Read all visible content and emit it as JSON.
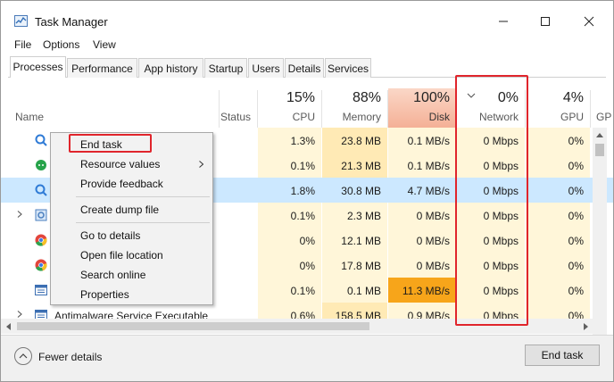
{
  "window": {
    "title": "Task Manager",
    "controls": [
      "minimize-icon",
      "maximize-icon",
      "close-icon"
    ]
  },
  "menu": [
    "File",
    "Options",
    "View"
  ],
  "tabs": [
    "Processes",
    "Performance",
    "App history",
    "Startup",
    "Users",
    "Details",
    "Services"
  ],
  "active_tab": "Processes",
  "columns": {
    "name": "Name",
    "status": "Status",
    "cpu": {
      "pct": "15%",
      "label": "CPU"
    },
    "memory": {
      "pct": "88%",
      "label": "Memory"
    },
    "disk": {
      "pct": "100%",
      "label": "Disk"
    },
    "network": {
      "pct": "0%",
      "label": "Network",
      "sorted_icon": "chevron-down-icon"
    },
    "gpu": {
      "pct": "4%",
      "label": "GPU"
    },
    "gpu_engine": {
      "label": "GP"
    }
  },
  "rows": [
    {
      "name": "",
      "cpu": "1.3%",
      "mem": "23.8 MB",
      "disk": "0.1 MB/s",
      "net": "0 Mbps",
      "gpu": "0%",
      "icon": "search-app-icon"
    },
    {
      "name": "",
      "cpu": "0.1%",
      "mem": "21.3 MB",
      "disk": "0.1 MB/s",
      "net": "0 Mbps",
      "gpu": "0%",
      "icon": "chat-app-icon"
    },
    {
      "name": "",
      "cpu": "1.8%",
      "mem": "30.8 MB",
      "disk": "4.7 MB/s",
      "net": "0 Mbps",
      "gpu": "0%",
      "icon": "search-app-icon",
      "selected": true
    },
    {
      "name": "",
      "cpu": "0.1%",
      "mem": "2.3 MB",
      "disk": "0 MB/s",
      "net": "0 Mbps",
      "gpu": "0%",
      "icon": "service-gear-icon",
      "expandable": true
    },
    {
      "name": "",
      "cpu": "0%",
      "mem": "12.1 MB",
      "disk": "0 MB/s",
      "net": "0 Mbps",
      "gpu": "0%",
      "icon": "chrome-icon"
    },
    {
      "name": "",
      "cpu": "0%",
      "mem": "17.8 MB",
      "disk": "0 MB/s",
      "net": "0 Mbps",
      "gpu": "0%",
      "icon": "chrome-icon"
    },
    {
      "name": "",
      "cpu": "0.1%",
      "mem": "0.1 MB",
      "disk": "11.3 MB/s",
      "net": "0 Mbps",
      "gpu": "0%",
      "icon": "window-app-icon"
    },
    {
      "name": "Antimalware Service Executable",
      "cpu": "0.6%",
      "mem": "158.5 MB",
      "disk": "0.9 MB/s",
      "net": "0 Mbps",
      "gpu": "0%",
      "icon": "window-app-icon",
      "expandable": true
    }
  ],
  "context_menu": {
    "items": [
      "End task",
      "Resource values",
      "Provide feedback",
      "Create dump file",
      "Go to details",
      "Open file location",
      "Search online",
      "Properties"
    ],
    "submenu_item": "Resource values"
  },
  "footer": {
    "fewer_details": "Fewer details",
    "end_task": "End task"
  },
  "colors": {
    "heat_light": "#fff6d9",
    "heat_mid": "#ffeab5",
    "heat_hot": "#f7a51a",
    "disk_header": "#f9c7b0",
    "selection": "#cce8ff",
    "highlight_box": "#e0252c"
  }
}
